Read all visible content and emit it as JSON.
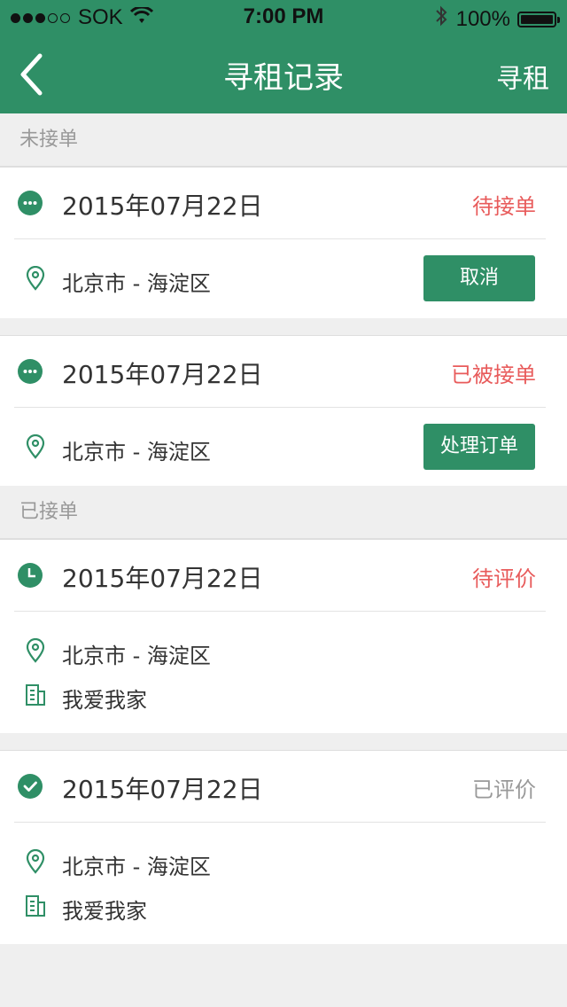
{
  "status_bar": {
    "carrier": "SOK",
    "time": "7:00 PM",
    "battery": "100%"
  },
  "nav": {
    "title": "寻租记录",
    "right_label": "寻租"
  },
  "sections": {
    "pending": "未接单",
    "accepted": "已接单"
  },
  "records": [
    {
      "date": "2015年07月22日",
      "status": "待接单",
      "location": "北京市 - 海淀区",
      "button": "取消"
    },
    {
      "date": "2015年07月22日",
      "status": "已被接单",
      "location": "北京市 - 海淀区",
      "button": "处理订单"
    },
    {
      "date": "2015年07月22日",
      "status": "待评价",
      "location": "北京市 - 海淀区",
      "agency": "我爱我家"
    },
    {
      "date": "2015年07月22日",
      "status": "已评价",
      "location": "北京市 - 海淀区",
      "agency": "我爱我家"
    }
  ],
  "colors": {
    "brand": "#2f8f66",
    "pending_status": "#e85b5b",
    "done_status": "#999999",
    "background": "#efefef"
  },
  "icons": {
    "pending": "more-dots-icon",
    "awaiting_review": "clock-icon",
    "reviewed": "check-circle-icon",
    "location": "location-pin-icon",
    "agency": "building-icon"
  }
}
